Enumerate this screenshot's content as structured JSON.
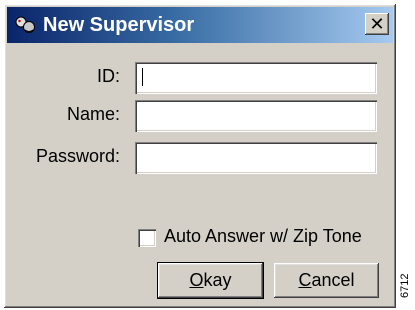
{
  "window": {
    "title": "New Supervisor",
    "close_glyph": "✕",
    "icon": "supervisor-app-icon"
  },
  "form": {
    "id_label": "ID:",
    "id_value": "",
    "name_label": "Name:",
    "name_value": "",
    "password_label": "Password:",
    "password_value": ""
  },
  "options": {
    "auto_answer_label": "Auto Answer w/ Zip Tone",
    "auto_answer_checked": false
  },
  "buttons": {
    "okay_mnemonic": "O",
    "okay_rest": "kay",
    "cancel_mnemonic": "C",
    "cancel_rest": "ancel"
  },
  "figure_code": "6712"
}
